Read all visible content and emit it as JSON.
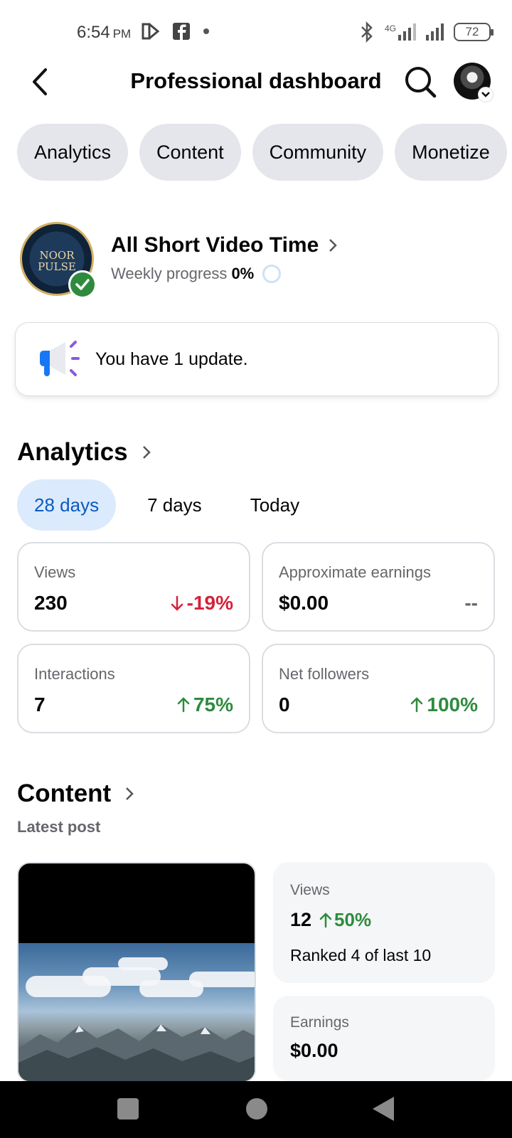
{
  "status_bar": {
    "time": "6:54",
    "ampm": "PM",
    "network": "4G",
    "battery": "72"
  },
  "header": {
    "title": "Professional dashboard"
  },
  "tabs": [
    {
      "label": "Analytics"
    },
    {
      "label": "Content"
    },
    {
      "label": "Community"
    },
    {
      "label": "Monetize"
    }
  ],
  "profile": {
    "name": "All Short Video Time",
    "weekly_label": "Weekly progress",
    "weekly_value": "0%",
    "logo_text": "NOOR PULSE"
  },
  "update": {
    "text": "You have 1 update."
  },
  "analytics": {
    "title": "Analytics",
    "ranges": [
      {
        "label": "28 days",
        "active": true
      },
      {
        "label": "7 days",
        "active": false
      },
      {
        "label": "Today",
        "active": false
      }
    ],
    "metrics": [
      {
        "label": "Views",
        "value": "230",
        "change": "-19%",
        "direction": "down"
      },
      {
        "label": "Approximate earnings",
        "value": "$0.00",
        "change": "--",
        "direction": "none"
      },
      {
        "label": "Interactions",
        "value": "7",
        "change": "75%",
        "direction": "up"
      },
      {
        "label": "Net followers",
        "value": "0",
        "change": "100%",
        "direction": "up"
      }
    ]
  },
  "content": {
    "title": "Content",
    "latest_label": "Latest post",
    "views_label": "Views",
    "views_value": "12",
    "views_change": "50%",
    "rank_text": "Ranked 4 of last 10",
    "earnings_label": "Earnings",
    "earnings_value": "$0.00"
  },
  "colors": {
    "accent_blue": "#0a5ac2",
    "down_red": "#d4213a",
    "up_green": "#2e8b3e",
    "pill_gray": "#e4e6eb"
  }
}
